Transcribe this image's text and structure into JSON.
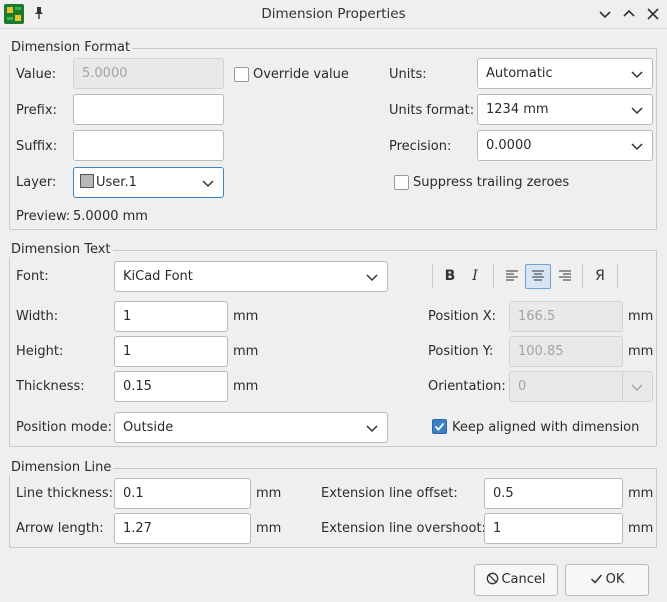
{
  "window": {
    "title": "Dimension Properties"
  },
  "format": {
    "title": "Dimension Format",
    "value_label": "Value:",
    "value": "5.0000",
    "override_label": "Override value",
    "prefix_label": "Prefix:",
    "prefix": "",
    "suffix_label": "Suffix:",
    "suffix": "",
    "layer_label": "Layer:",
    "layer": "User.1",
    "preview_label": "Preview:",
    "preview": "5.0000 mm",
    "units_label": "Units:",
    "units": "Automatic",
    "units_format_label": "Units format:",
    "units_format": "1234 mm",
    "precision_label": "Precision:",
    "precision": "0.0000",
    "suppress_label": "Suppress trailing zeroes"
  },
  "text": {
    "title": "Dimension Text",
    "font_label": "Font:",
    "font": "KiCad Font",
    "bold": "B",
    "italic": "I",
    "mirror": "Я",
    "width_label": "Width:",
    "width": "1",
    "height_label": "Height:",
    "height": "1",
    "thickness_label": "Thickness:",
    "thickness": "0.15",
    "unit": "mm",
    "posx_label": "Position X:",
    "posx": "166.5",
    "posy_label": "Position Y:",
    "posy": "100.85",
    "orientation_label": "Orientation:",
    "orientation": "0",
    "position_mode_label": "Position mode:",
    "position_mode": "Outside",
    "keep_aligned_label": "Keep aligned with dimension"
  },
  "line": {
    "title": "Dimension Line",
    "line_thickness_label": "Line thickness:",
    "line_thickness": "0.1",
    "arrow_length_label": "Arrow length:",
    "arrow_length": "1.27",
    "ext_offset_label": "Extension line offset:",
    "ext_offset": "0.5",
    "ext_overshoot_label": "Extension line overshoot:",
    "ext_overshoot": "1",
    "unit": "mm"
  },
  "buttons": {
    "cancel": "Cancel",
    "ok": "OK"
  },
  "colors": {
    "accent": "#3b7fc4",
    "app_icon": "#1b7a2e"
  }
}
